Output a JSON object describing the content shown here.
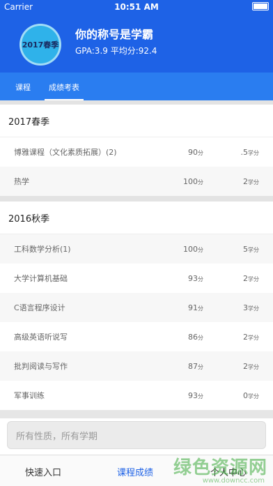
{
  "status": {
    "carrier": "Carrier",
    "time": "10:51 AM"
  },
  "profile": {
    "avatar_label": "2017春季",
    "title": "你的称号是学霸",
    "gpa_text": "GPA:3.9   平均分:92.4"
  },
  "tabs": [
    "课程",
    "成绩考表"
  ],
  "sections": [
    {
      "term": "2017春季",
      "rows": [
        {
          "name": "博雅课程（文化素质拓展）(2)",
          "score": "90",
          "credit": ".5"
        },
        {
          "name": "热学",
          "score": "100",
          "credit": "2"
        }
      ]
    },
    {
      "term": "2016秋季",
      "rows": [
        {
          "name": "工科数学分析(1)",
          "score": "100",
          "credit": "5"
        },
        {
          "name": "大学计算机基础",
          "score": "93",
          "credit": "2"
        },
        {
          "name": "C语言程序设计",
          "score": "91",
          "credit": "3"
        },
        {
          "name": "高级英语听说写",
          "score": "86",
          "credit": "2"
        },
        {
          "name": "批判阅读与写作",
          "score": "87",
          "credit": "2"
        },
        {
          "name": "军事训练",
          "score": "93",
          "credit": "0"
        }
      ]
    }
  ],
  "units": {
    "score": "分",
    "credit": "学分"
  },
  "filter": {
    "text": "所有性质，所有学期"
  },
  "bottom_nav": [
    "快速入口",
    "课程成绩",
    "个人中心"
  ],
  "watermark": {
    "main": "绿色资源网",
    "sub": "www.downcc.com"
  }
}
